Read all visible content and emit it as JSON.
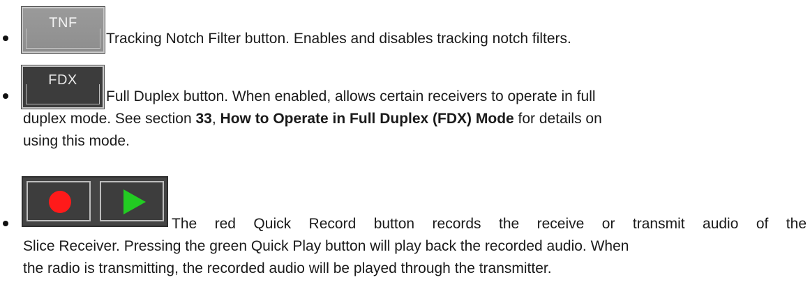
{
  "tnf": {
    "button_label": "TNF",
    "description": "Tracking Notch Filter button.  Enables and disables tracking notch filters."
  },
  "fdx": {
    "button_label": "FDX",
    "line1": "Full Duplex button.  When enabled, allows certain receivers to operate in full",
    "line2_pre": "duplex mode.  See section ",
    "section_number": "33",
    "line2_sep": ", ",
    "section_title": "How to Operate in Full Duplex (FDX) Mode",
    "line2_post": " for details on",
    "line3": "using this mode."
  },
  "record_play": {
    "line1": "The red Quick Record button records the receive or transmit audio of the",
    "line2": "Slice Receiver.  Pressing the green Quick Play button will play back the recorded audio.  When",
    "line3": "the radio is transmitting, the recorded audio will be played through the transmitter.",
    "colors": {
      "record": "#ff1a1a",
      "play": "#22cc22",
      "panel": "#444444"
    }
  }
}
